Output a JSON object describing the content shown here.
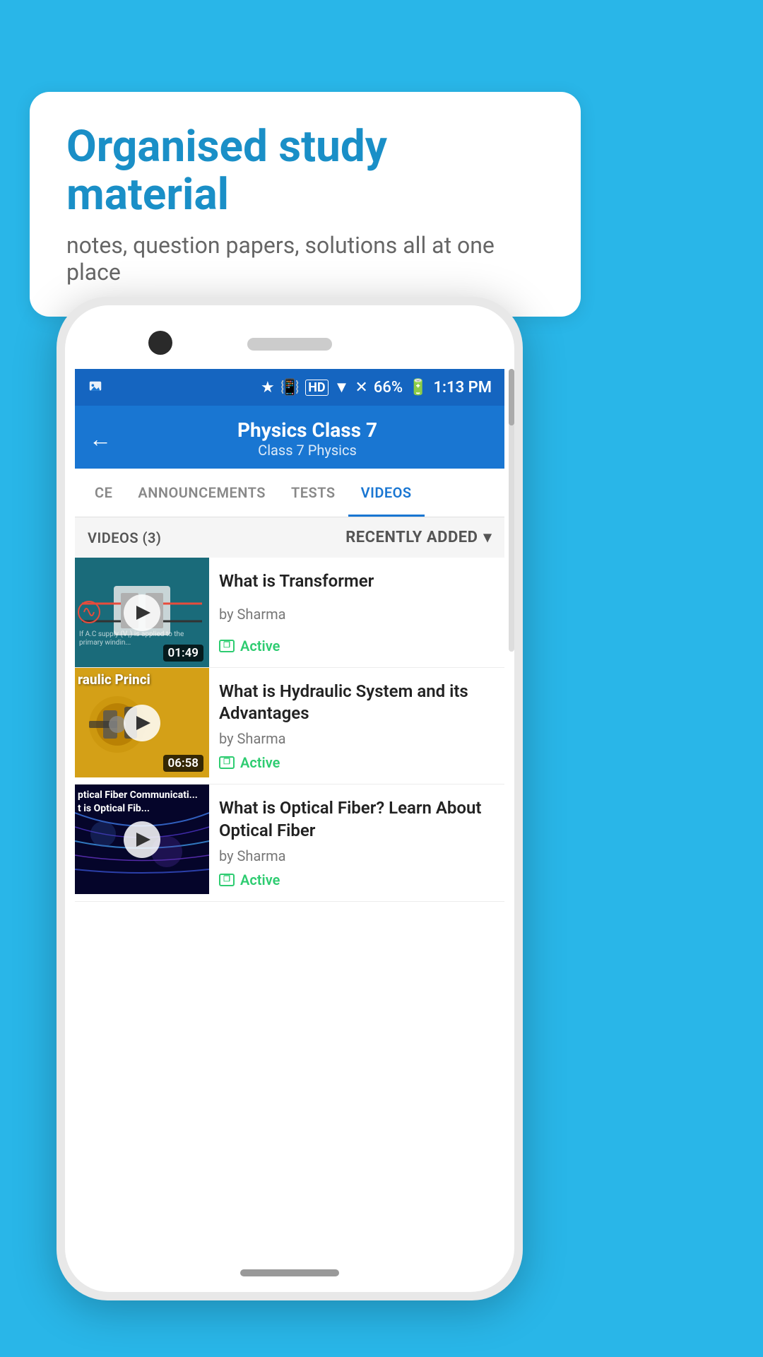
{
  "background_color": "#29b6e8",
  "bubble": {
    "title": "Organised study material",
    "subtitle": "notes, question papers, solutions all at one place"
  },
  "status_bar": {
    "time": "1:13 PM",
    "battery": "66%",
    "signal_icon": "signal",
    "bluetooth_icon": "bluetooth",
    "wifi_icon": "wifi"
  },
  "header": {
    "title": "Physics Class 7",
    "breadcrumb": "Class 7   Physics",
    "back_label": "←"
  },
  "tabs": [
    {
      "label": "CE",
      "active": false
    },
    {
      "label": "ANNOUNCEMENTS",
      "active": false
    },
    {
      "label": "TESTS",
      "active": false
    },
    {
      "label": "VIDEOS",
      "active": true
    }
  ],
  "videos_section": {
    "count_label": "VIDEOS (3)",
    "sort_label": "RECENTLY ADDED",
    "sort_icon": "▾"
  },
  "videos": [
    {
      "title": "What is  Transformer",
      "author": "by Sharma",
      "status": "Active",
      "duration": "01:49",
      "thumb_type": "transformer",
      "thumb_text": "If A.C supply (V₁) is applied to the primary windin..."
    },
    {
      "title": "What is Hydraulic System and its Advantages",
      "author": "by Sharma",
      "status": "Active",
      "duration": "06:58",
      "thumb_type": "hydraulic",
      "thumb_label": "raulic Princi"
    },
    {
      "title": "What is Optical Fiber? Learn About Optical Fiber",
      "author": "by Sharma",
      "status": "Active",
      "duration": "",
      "thumb_type": "optical",
      "thumb_label": "ptical Fiber Communicati...\nt is Optical Fib..."
    }
  ]
}
